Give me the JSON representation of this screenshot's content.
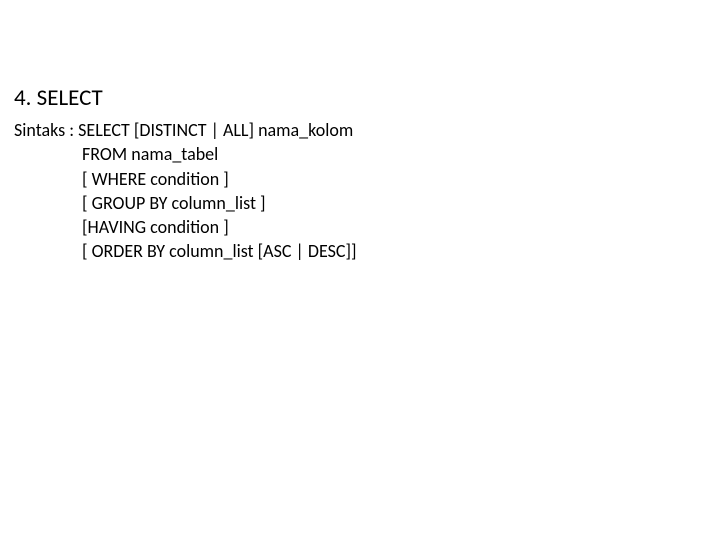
{
  "title": "4.  SELECT",
  "syntax": {
    "line1": "Sintaks : SELECT [DISTINCT | ALL] nama_kolom",
    "line2": "FROM nama_tabel",
    "line3": "[ WHERE condition ]",
    "line4": "[ GROUP BY column_list ]",
    "line5": "[HAVING condition ]",
    "line6": "[ ORDER BY column_list [ASC | DESC]]"
  }
}
